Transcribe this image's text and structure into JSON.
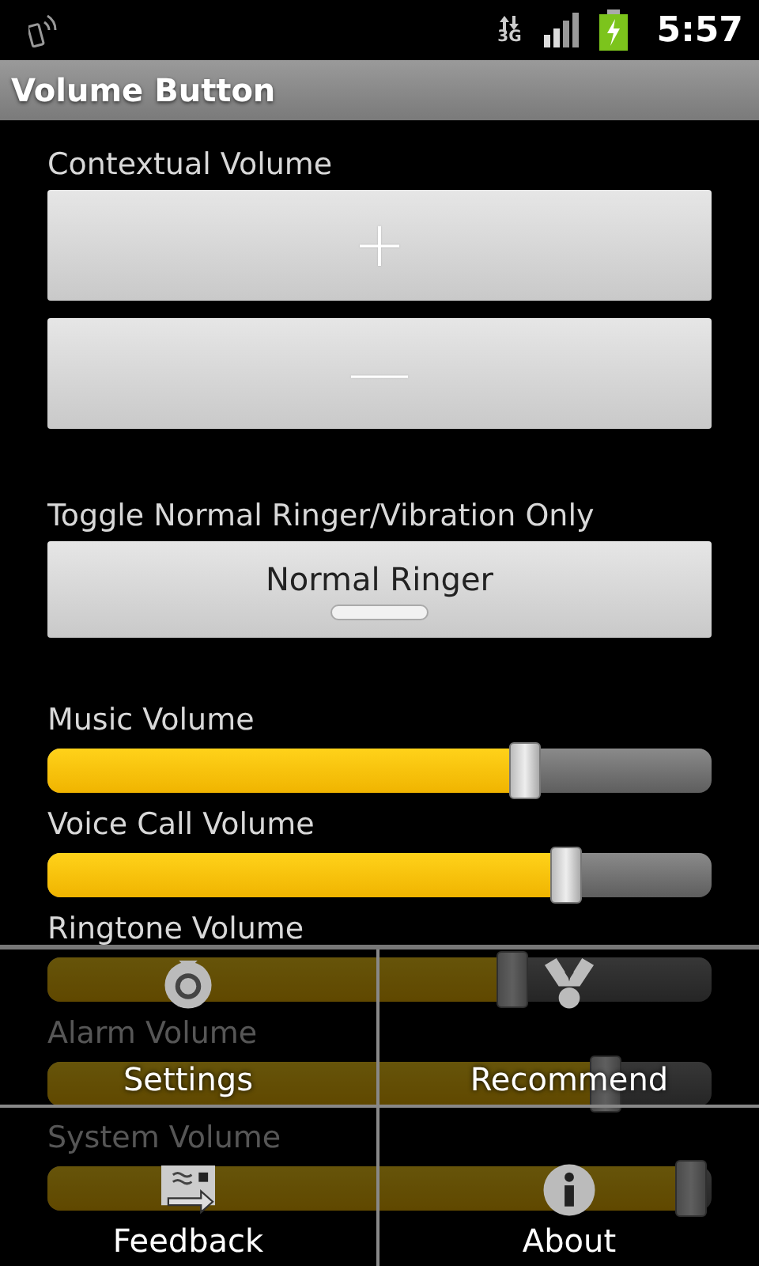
{
  "status_bar": {
    "network": "3G",
    "time": "5:57"
  },
  "title_bar": {
    "title": "Volume Button"
  },
  "contextual": {
    "label": "Contextual Volume",
    "buttons": [
      "+",
      "—"
    ]
  },
  "toggle": {
    "label": "Toggle Normal Ringer/Vibration Only",
    "button": "Normal Ringer",
    "on": false
  },
  "sliders": [
    {
      "label": "Music Volume",
      "level": 0.72
    },
    {
      "label": "Voice Call Volume",
      "level": 0.78
    },
    {
      "label": "Ringtone Volume",
      "level": 0.7
    },
    {
      "label": "Alarm Volume",
      "level": 0.84
    },
    {
      "label": "System Volume",
      "level": 0.97
    }
  ],
  "menu": [
    {
      "label": "Settings"
    },
    {
      "label": "Recommend"
    },
    {
      "label": "Feedback"
    },
    {
      "label": "About"
    }
  ]
}
